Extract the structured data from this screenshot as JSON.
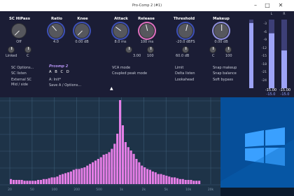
{
  "window": {
    "title": "Pro-Comp 2 (#1)",
    "controls": [
      "–",
      "□",
      "✕"
    ]
  },
  "plugin": {
    "headers": {
      "sc_hipass": "SC HiPass",
      "ratio": "Ratio",
      "knee": "Knee",
      "attack": "Attack",
      "release": "Release",
      "threshold": "Threshold",
      "makeup": "Makeup"
    },
    "values": {
      "sc_hipass": "Off",
      "ratio": "4.0",
      "knee": "0.00 dB",
      "attack": "8.0 ms",
      "release": "100 ms",
      "threshold": "-20.0 dBFS",
      "makeup": "0.00 dB"
    },
    "small_knobs": {
      "linked_label": "Linked",
      "c1_label": "C",
      "c2_label": "C",
      "release_min": "3.00",
      "release_max": "100",
      "threshold_db": "60.0 dB",
      "c3_label": "C",
      "c4_label": "C",
      "makeup_max": "100"
    },
    "options": {
      "sc_options": "SC Options...",
      "sc_listen": "SC listen",
      "external_sc": "External SC",
      "mid_side": "Mid / side",
      "program_name": "Prcomp 2",
      "program_slots": [
        "A",
        "B",
        "C",
        "D"
      ],
      "program_current": "A: Init*",
      "save_options": "Save A / Options...",
      "vca_mode": "VCA mode",
      "coupled_peak": "Coupled peak mode",
      "limit": "Limit",
      "delta_listen": "Delta listen",
      "lookahead": "Lookahead",
      "snap_makeup": "Snap makeup",
      "snap_balance": "Snap balance",
      "soft_bypass": "Soft bypass"
    },
    "knob_levels": {
      "sc_hipass": 0,
      "ratio": 0.35,
      "knee": 0,
      "attack": 0.3,
      "release": 0.45,
      "threshold": 0.55,
      "makeup": 0.5
    }
  },
  "meters": {
    "channels": [
      "L",
      "R"
    ],
    "ticks": [
      "-3",
      "-6",
      "-9",
      "-12",
      "-15",
      "-18",
      "-21",
      "-24"
    ],
    "left_peak": "-15.00",
    "left_rms": "-15.0",
    "right_peak": "-15.00",
    "right_rms": "-15.0",
    "colors": {
      "bar": "#9da3f6",
      "bar_dark": "#3d3f77",
      "peak": "#b6b9ff"
    },
    "levels": {
      "left_bar": 0.8,
      "right_bar": 0.55,
      "gr_bar": 0.95
    }
  },
  "analyzer": {
    "colors": {
      "bars": "#e57ee6",
      "grid": "#3b5a74",
      "bg": "#1e3348"
    },
    "freq_labels": [
      "20",
      "50",
      "100",
      "200",
      "500",
      "1k",
      "2k",
      "5k",
      "10k",
      "20k"
    ],
    "bars": [
      0.06,
      0.05,
      0.05,
      0.05,
      0.05,
      0.04,
      0.04,
      0.04,
      0.04,
      0.04,
      0.05,
      0.05,
      0.06,
      0.06,
      0.07,
      0.08,
      0.08,
      0.09,
      0.11,
      0.12,
      0.13,
      0.14,
      0.15,
      0.17,
      0.18,
      0.18,
      0.19,
      0.2,
      0.22,
      0.24,
      0.26,
      0.28,
      0.3,
      0.32,
      0.35,
      0.36,
      0.38,
      0.42,
      0.48,
      0.6,
      1.0,
      0.7,
      0.5,
      0.44,
      0.4,
      0.36,
      0.3,
      0.26,
      0.22,
      0.2,
      0.18,
      0.17,
      0.15,
      0.14,
      0.12,
      0.12,
      0.11,
      0.1,
      0.09,
      0.08,
      0.08,
      0.07,
      0.06,
      0.06,
      0.05,
      0.05,
      0.05,
      0.04,
      0.04,
      0.04
    ]
  },
  "desktop": {
    "colors": {
      "bg": "#064f9a",
      "logo": "#3aa0ff"
    }
  }
}
